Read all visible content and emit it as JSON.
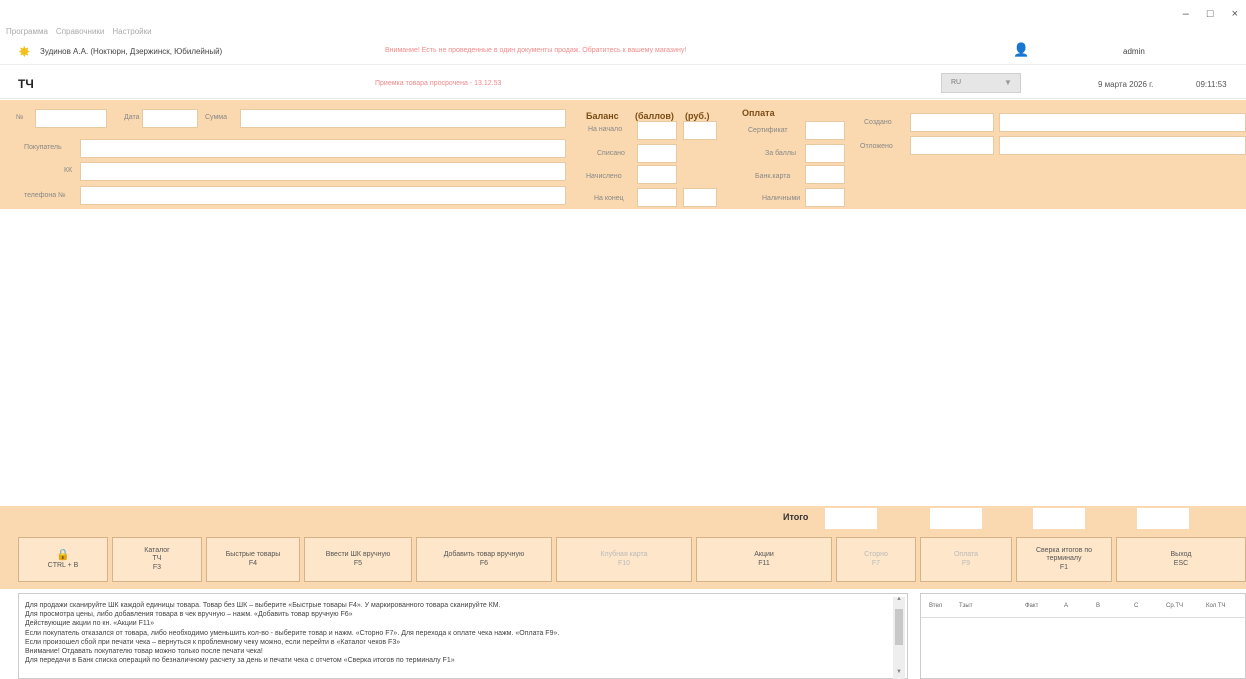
{
  "window": {
    "minimize": "–",
    "maximize": "□",
    "close": "×"
  },
  "menu": [
    "Программа",
    "Справочники",
    "Настройки"
  ],
  "topbar": {
    "store": "Зудинов А.А. (Ноктюрн, Дзержинск, Юбилейный)",
    "warning": "Внимание! Есть не проведенные в один документы продаж. Обратитесь к вашему магазину!",
    "user": "admin"
  },
  "titlebar": {
    "title": "ТЧ",
    "status": "Приемка товара просрочена - 13.12.53",
    "lang": "RU",
    "date": "9 марта 2026 г.",
    "time": "09:11:53"
  },
  "form": {
    "num_label": "№",
    "date_label": "Дата",
    "sum_label": "Сумма",
    "buyer_label": "Покупатель",
    "kk_label": "КК",
    "phone_label": "телефона №",
    "balance_header": "Баланс",
    "points_header": "(баллов)",
    "rub_header": "(руб.)",
    "payment_header": "Оплата",
    "start_label": "На начало",
    "written_label": "Списано",
    "accrued_label": "Начислено",
    "end_label": "На конец",
    "cert_label": "Сертификат",
    "for_points_label": "За баллы",
    "bank_card_label": "Банк.карта",
    "cash_label": "Наличными",
    "created_label": "Создано",
    "modified_label": "Отложено"
  },
  "totals": {
    "label": "Итого"
  },
  "buttons": [
    {
      "icon": "🔒",
      "line1": "",
      "line2": "CTRL + B",
      "disabled": false
    },
    {
      "line1": "Каталог",
      "line2": "ТЧ",
      "line3": "F3",
      "disabled": false
    },
    {
      "line1": "Быстрые товары",
      "line2": "F4",
      "disabled": false
    },
    {
      "line1": "Ввести ШК вручную",
      "line2": "F5",
      "disabled": false
    },
    {
      "line1": "Добавить товар вручную",
      "line2": "F6",
      "disabled": false
    },
    {
      "line1": "Клубная карта",
      "line2": "F10",
      "disabled": true
    },
    {
      "line1": "Акции",
      "line2": "F11",
      "disabled": false
    },
    {
      "line1": "Сторно",
      "line2": "F7",
      "disabled": true
    },
    {
      "line1": "Оплата",
      "line2": "F9",
      "disabled": true
    },
    {
      "line1": "Сверка итогов по терминалу",
      "line2": "F1",
      "disabled": false
    },
    {
      "line1": "Выход",
      "line2": "ESC",
      "disabled": false
    }
  ],
  "help": [
    "Для продажи сканируйте ШК каждой единицы товара. Товар без ШК – выберите «Быстрые товары F4». У маркированного товара сканируйте КМ.",
    "Для просмотра цены, либо добавления товара в чек вручную – нажм. «Добавить товар вручную F6»",
    "Действующие акции по кн. «Акции F11»",
    "Если покупатель отказался от товара, либо необходимо уменьшить кол-во - выберите товар и нажм. «Сторно F7». Для перехода к оплате чека нажм. «Оплата F9».",
    "Если произошел сбой при печати чека – вернуться к проблемному чеку можно, если перейти в «Каталог чеков F3»",
    "Внимание! Отдавать покупателю товар можно только после печати чека!",
    "Для передачи в Банк списка операций по безналичному расчету за день и печати чека с отчетом «Сверка итогов по терминалу F1»"
  ],
  "stats_columns": [
    "Втел",
    "Тзыт",
    "Факт",
    "А",
    "В",
    "С",
    "Ср.ТЧ",
    "Кол ТЧ"
  ]
}
